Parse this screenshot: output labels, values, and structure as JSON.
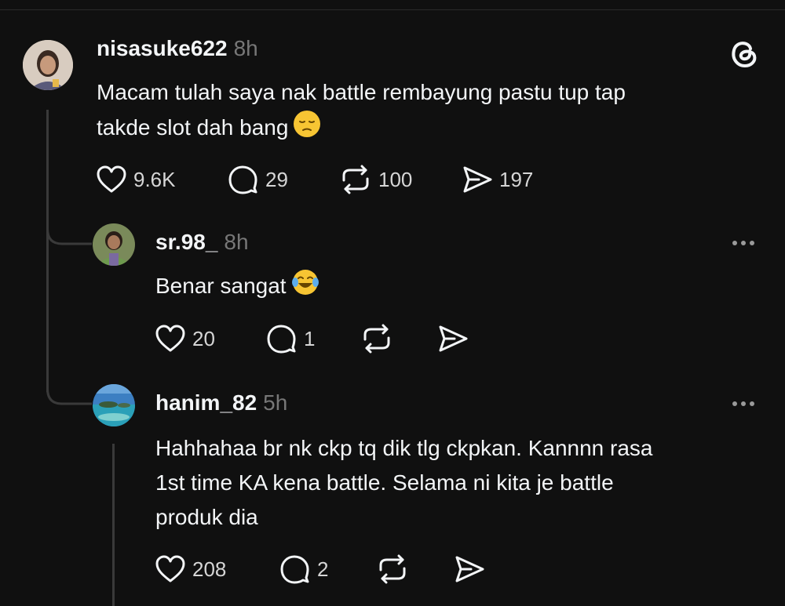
{
  "colors": {
    "background": "#101010",
    "text_primary": "#f3f5f7",
    "text_secondary": "#777777",
    "thread_line": "#3a3a3a"
  },
  "posts": [
    {
      "username": "nisasuke622",
      "time": "8h",
      "text_line_1": "Macam tulah saya nak battle rembayung pastu tup tap",
      "text_line_2": "takde slot dah bang",
      "emoji": "pensive-face",
      "likes": "9.6K",
      "replies": "29",
      "reposts": "100",
      "shares": "197"
    },
    {
      "username": "sr.98_",
      "time": "8h",
      "text_line_1": "Benar sangat",
      "emoji": "face-with-tears-of-joy",
      "likes": "20",
      "replies": "1"
    },
    {
      "username": "hanim_82",
      "time": "5h",
      "text_line_1": "Hahhahaa br nk ckp tq dik tlg ckpkan. Kannnn rasa",
      "text_line_2": "1st time KA kena battle. Selama ni kita je battle",
      "text_line_3": "produk dia",
      "likes": "208",
      "replies": "2"
    }
  ],
  "icons": [
    "threads-logo-icon",
    "heart-icon",
    "comment-icon",
    "repost-icon",
    "share-icon",
    "more-icon"
  ]
}
